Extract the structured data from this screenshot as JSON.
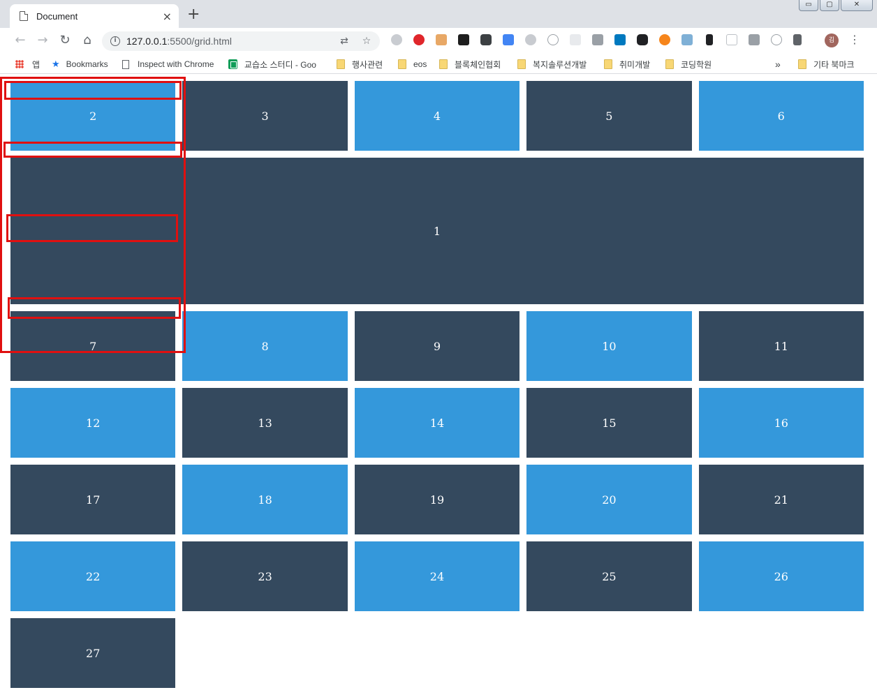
{
  "browser": {
    "tab_title": "Document",
    "tab_close": "×",
    "new_tab": "+",
    "window_buttons": [
      "▭",
      "▢",
      "✕"
    ],
    "nav": {
      "back": "←",
      "forward": "→",
      "reload": "↻",
      "home": "⌂"
    },
    "url_host": "127.0.0.1",
    "url_path": ":5500/grid.html",
    "info_glyph": "i",
    "avatar_initial": "김",
    "menu_glyph": "⋮",
    "bookmarks": [
      {
        "label": "앱",
        "icon": "apps-icon"
      },
      {
        "label": "Bookmarks",
        "icon": "star-icon"
      },
      {
        "label": "Inspect with Chrome",
        "icon": "page-icon"
      },
      {
        "label": "교습소 스터디 - Goo",
        "icon": "sheets-icon"
      },
      {
        "label": "행사관련",
        "icon": "folder-icon"
      },
      {
        "label": "eos",
        "icon": "folder-icon"
      },
      {
        "label": "블록체인협회",
        "icon": "folder-icon"
      },
      {
        "label": "복지솔루션개발",
        "icon": "folder-icon"
      },
      {
        "label": "취미개발",
        "icon": "folder-icon"
      },
      {
        "label": "코딩학원",
        "icon": "folder-icon"
      },
      {
        "label": "»",
        "icon": "overflow-chevron"
      },
      {
        "label": "기타 북마크",
        "icon": "folder-icon"
      }
    ]
  },
  "colors": {
    "light": "#3498db",
    "dark": "#34495e",
    "annotation": "#e01010"
  },
  "grid": {
    "items": [
      {
        "label": "2",
        "tone": "light"
      },
      {
        "label": "3",
        "tone": "dark"
      },
      {
        "label": "4",
        "tone": "light"
      },
      {
        "label": "5",
        "tone": "dark"
      },
      {
        "label": "6",
        "tone": "light"
      },
      {
        "label": "1",
        "tone": "dark",
        "span": true
      },
      {
        "label": "7",
        "tone": "dark"
      },
      {
        "label": "8",
        "tone": "light"
      },
      {
        "label": "9",
        "tone": "dark"
      },
      {
        "label": "10",
        "tone": "light"
      },
      {
        "label": "11",
        "tone": "dark"
      },
      {
        "label": "12",
        "tone": "light"
      },
      {
        "label": "13",
        "tone": "dark"
      },
      {
        "label": "14",
        "tone": "light"
      },
      {
        "label": "15",
        "tone": "dark"
      },
      {
        "label": "16",
        "tone": "light"
      },
      {
        "label": "17",
        "tone": "dark"
      },
      {
        "label": "18",
        "tone": "light"
      },
      {
        "label": "19",
        "tone": "dark"
      },
      {
        "label": "20",
        "tone": "light"
      },
      {
        "label": "21",
        "tone": "dark"
      },
      {
        "label": "22",
        "tone": "light"
      },
      {
        "label": "23",
        "tone": "dark"
      },
      {
        "label": "24",
        "tone": "light"
      },
      {
        "label": "25",
        "tone": "dark"
      },
      {
        "label": "26",
        "tone": "light"
      },
      {
        "label": "27",
        "tone": "dark"
      }
    ]
  }
}
